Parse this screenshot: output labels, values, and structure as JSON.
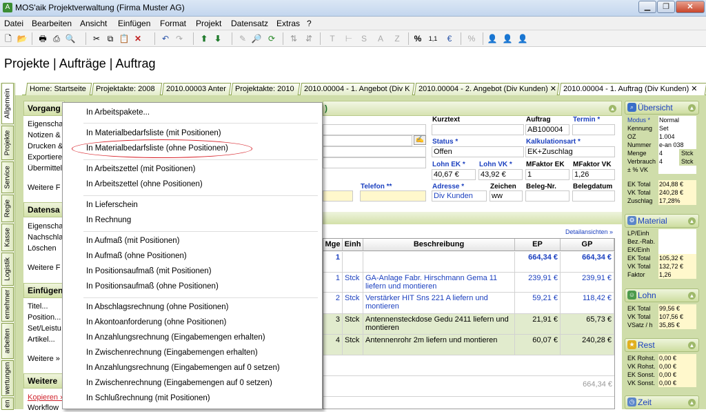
{
  "window": {
    "title": "MOS'aik Projektverwaltung (Firma Muster AG)",
    "controls": [
      "▁",
      "❐",
      "✕"
    ]
  },
  "menubar": [
    "Datei",
    "Bearbeiten",
    "Ansicht",
    "Einfügen",
    "Format",
    "Projekt",
    "Datensatz",
    "Extras",
    "?"
  ],
  "heading": "Projekte | Aufträge | Auftrag",
  "tabs": [
    "Home: Startseite",
    "Projektakte: 2008",
    "2010.00003 Anter",
    "Projektakte: 2010",
    "2010.00004 - 1. Angebot (Div K",
    "2010.00004 - 2. Angebot (Div Kunden) ✕",
    "2010.00004 - 1. Auftrag (Div Kunden) ✕"
  ],
  "vtabs": [
    "Allgemein",
    "Projekte",
    "Service",
    "Regie",
    "Kasse",
    "Logistik",
    "ernehmer",
    "arbeiten",
    "wertungen",
    "en"
  ],
  "left_panels": {
    "vorgang": {
      "title": "Vorgang",
      "items": [
        "Eigenscha",
        "Notizen &",
        "Drucken &",
        "Exportiere",
        "Übermittel"
      ],
      "more": "Weitere F"
    },
    "datensatz": {
      "title": "Datensa",
      "items": [
        "Eigenscha",
        "Nachschla",
        "Löschen"
      ],
      "more": "Weitere F"
    },
    "einfuegen": {
      "title": "Einfügen",
      "items": [
        "Titel...",
        "Position...",
        "Set/Leistu",
        "Artikel..."
      ],
      "more": "Weitere »"
    },
    "weitere": {
      "title": "Weitere",
      "items": [
        "Kopieren »",
        "Workflow"
      ]
    }
  },
  "context_menu": {
    "items": [
      "In Arbeitspakete...",
      "In Materialbedarfsliste (mit Positionen)",
      "In Materialbedarfsliste (ohne Positionen)",
      "In Arbeitszettel (mit Positionen)",
      "In Arbeitszettel (ohne Positionen)",
      "In Lieferschein",
      "In Rechnung",
      "In Aufmaß (mit Positionen)",
      "In Aufmaß (ohne Positionen)",
      "In Positionsaufmaß (mit Positionen)",
      "In Positionsaufmaß (ohne Positionen)",
      "In Abschlagsrechnung (ohne Positionen)",
      "In Akontoanforderung (ohne Positionen)",
      "In Anzahlungsrechnung (Eingabemengen erhalten)",
      "In Zwischenrechnung (Eingabemengen erhalten)",
      "In Anzahlungsrechnung (Eingabemengen auf 0 setzen)",
      "In Zwischenrechnung (Eingabemengen auf 0 setzen)",
      "In Schlußrechnung (mit Positionen)"
    ],
    "highlighted": "In Materialbedarfsliste (ohne Positionen)"
  },
  "form": {
    "header_fragment": ")",
    "kurztext_label": "Kurztext",
    "auftrag_label": "Auftrag",
    "auftrag_value": "AB100004",
    "termin_label": "Termin *",
    "status_label": "Status *",
    "status_value": "Offen",
    "kalkulationsart_label": "Kalkulationsart *",
    "kalkulationsart_value": "EK+Zuschlag",
    "lohn_ek_label": "Lohn EK *",
    "lohn_ek_value": "40,67 €",
    "lohn_vk_label": "Lohn VK *",
    "lohn_vk_value": "43,92 €",
    "mfaktor_ek_label": "MFaktor EK",
    "mfaktor_ek_value": "1",
    "mfaktor_vk_label": "MFaktor VK",
    "mfaktor_vk_value": "1,26",
    "telefon_label": "Telefon **",
    "adresse_label": "Adresse *",
    "adresse_value": "Div Kunden",
    "zeichen_label": "Zeichen",
    "zeichen_value": "ww",
    "belegnr_label": "Beleg-Nr.",
    "belegdatum_label": "Belegdatum",
    "detailansichten": "Detailansichten »"
  },
  "grid": {
    "columns": [
      "Mge",
      "Einh",
      "Beschreibung",
      "EP",
      "GP"
    ],
    "rows": [
      {
        "mge": "1",
        "einh": "",
        "desc": "",
        "ep": "664,34 €",
        "gp": "664,34 €",
        "style": "header"
      },
      {
        "mge": "1",
        "einh": "Stck",
        "desc": "GA-Anlage Fabr. Hirschmann Gema 11 liefern und montieren",
        "ep": "239,91 €",
        "gp": "239,91 €",
        "style": "blue"
      },
      {
        "mge": "2",
        "einh": "Stck",
        "desc": "Verstärker HIT Sns 221 A liefern und montieren",
        "ep": "59,21 €",
        "gp": "118,42 €",
        "style": "blue"
      },
      {
        "mge": "3",
        "einh": "Stck",
        "desc": "Antennensteckdose Gedu 2411 liefern und montieren",
        "ep": "21,91 €",
        "gp": "65,73 €",
        "style": "green"
      },
      {
        "mge": "4",
        "einh": "Stck",
        "desc": "Antennenrohr 2m liefern und montieren",
        "ep": "60,07 €",
        "gp": "240,28 €",
        "style": "green"
      }
    ],
    "total": "664,34 €"
  },
  "right_panels": {
    "uebersicht": {
      "title": "Übersicht",
      "rows": [
        {
          "k": "Modus *",
          "v": "Normal"
        },
        {
          "k": "Kennung",
          "v": "Set"
        },
        {
          "k": "OZ",
          "v": "1.004"
        },
        {
          "k": "Nummer",
          "v": "e-an 038"
        },
        {
          "k": "Menge",
          "v": "4",
          "u": "Stck"
        },
        {
          "k": "Verbrauch",
          "v": "4",
          "u": "Stck"
        },
        {
          "k": "± % VK",
          "v": ""
        }
      ],
      "totals": [
        {
          "k": "EK Total",
          "v": "204,88 €"
        },
        {
          "k": "VK Total",
          "v": "240,28 €"
        },
        {
          "k": "Zuschlag",
          "v": "17,28%"
        }
      ]
    },
    "material": {
      "title": "Material",
      "rows": [
        {
          "k": "LP/Einh",
          "v": ""
        },
        {
          "k": "Bez.-Rab.",
          "v": ""
        },
        {
          "k": "EK/Einh",
          "v": ""
        },
        {
          "k": "EK Total",
          "v": "105,32 €"
        },
        {
          "k": "VK Total",
          "v": "132,72 €"
        },
        {
          "k": "Faktor",
          "v": "1,26"
        }
      ]
    },
    "lohn": {
      "title": "Lohn",
      "rows": [
        {
          "k": "EK Total",
          "v": "99,56 €"
        },
        {
          "k": "VK Total",
          "v": "107,56 €"
        },
        {
          "k": "VSatz / h",
          "v": "35,85 €"
        }
      ]
    },
    "rest": {
      "title": "Rest",
      "rows": [
        {
          "k": "EK Rohst.",
          "v": "0,00 €"
        },
        {
          "k": "VK Rohst.",
          "v": "0,00 €"
        },
        {
          "k": "EK Sonst.",
          "v": "0,00 €"
        },
        {
          "k": "VK Sonst.",
          "v": "0,00 €"
        }
      ]
    },
    "zeit": {
      "title": "Zeit"
    }
  },
  "colors": {
    "accent_green": "#cfddaa",
    "link_blue": "#1a3fbf",
    "highlight_red": "#d8262d"
  }
}
